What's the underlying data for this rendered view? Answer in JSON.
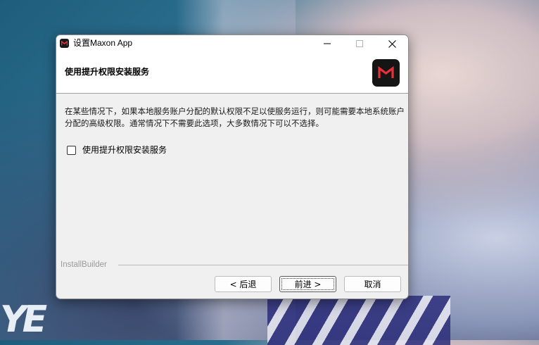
{
  "window": {
    "title": "设置Maxon App",
    "icon": "maxon-logo-icon"
  },
  "header": {
    "title": "使用提升权限安装服务",
    "logo": "maxon-logo-icon"
  },
  "body": {
    "description": "在某些情况下，如果本地服务账户分配的默认权限不足以使服务运行，则可能需要本地系统账户分配的高级权限。通常情况下不需要此选项，大多数情况下可以不选择。",
    "checkbox_label": "使用提升权限安装服务",
    "checkbox_checked": false
  },
  "footer": {
    "brand": "InstallBuilder",
    "back_label": "< 后退",
    "next_label": "前进 >",
    "cancel_label": "取消"
  },
  "colors": {
    "accent_logo": "#e8303a",
    "logo_bg": "#151515"
  }
}
